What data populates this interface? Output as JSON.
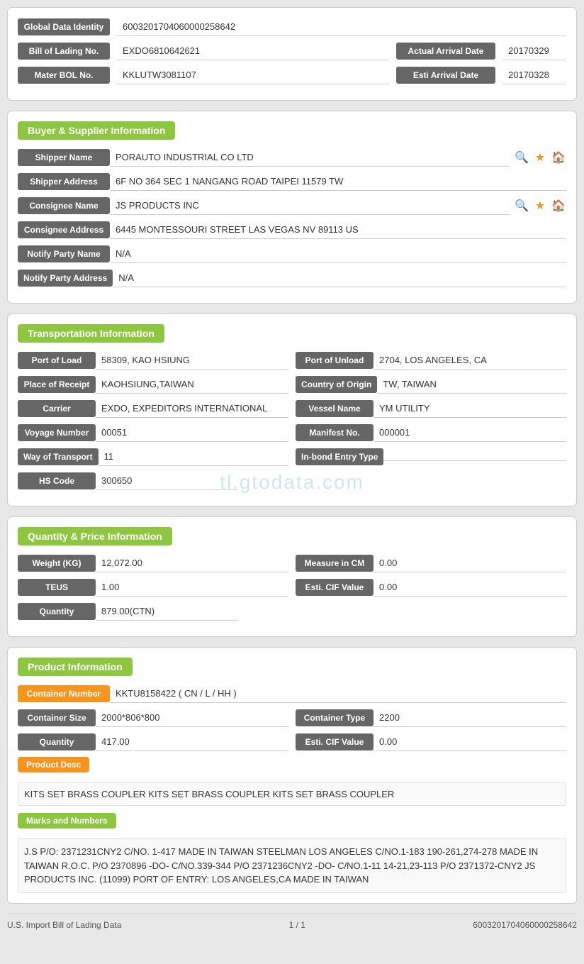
{
  "identity": {
    "global_label": "Global Data Identity",
    "global_value": "600320170406000025864​2",
    "bol_label": "Bill of Lading No.",
    "bol_value": "EXDO6810642621",
    "actual_arrival_label": "Actual Arrival Date",
    "actual_arrival_value": "20170329",
    "mater_bol_label": "Mater BOL No.",
    "mater_bol_value": "KKLUTW3081107",
    "esti_arrival_label": "Esti Arrival Date",
    "esti_arrival_value": "20170328"
  },
  "buyer_supplier": {
    "header": "Buyer & Supplier Information",
    "shipper_name_label": "Shipper Name",
    "shipper_name_value": "PORAUTO INDUSTRIAL CO LTD",
    "shipper_address_label": "Shipper Address",
    "shipper_address_value": "6F NO 364 SEC 1 NANGANG ROAD TAIPEI 11579 TW",
    "consignee_name_label": "Consignee Name",
    "consignee_name_value": "JS PRODUCTS INC",
    "consignee_address_label": "Consignee Address",
    "consignee_address_value": "6445 MONTESSOURI STREET LAS VEGAS NV 89113 US",
    "notify_party_name_label": "Notify Party Name",
    "notify_party_name_value": "N/A",
    "notify_party_address_label": "Notify Party Address",
    "notify_party_address_value": "N/A"
  },
  "transportation": {
    "header": "Transportation Information",
    "port_load_label": "Port of Load",
    "port_load_value": "58309, KAO HSIUNG",
    "port_unload_label": "Port of Unload",
    "port_unload_value": "2704, LOS ANGELES, CA",
    "place_receipt_label": "Place of Receipt",
    "place_receipt_value": "KAOHSIUNG,TAIWAN",
    "country_origin_label": "Country of Origin",
    "country_origin_value": "TW, TAIWAN",
    "carrier_label": "Carrier",
    "carrier_value": "EXDO, EXPEDITORS INTERNATIONAL",
    "vessel_name_label": "Vessel Name",
    "vessel_name_value": "YM UTILITY",
    "voyage_number_label": "Voyage Number",
    "voyage_number_value": "00051",
    "manifest_no_label": "Manifest No.",
    "manifest_no_value": "000001",
    "way_transport_label": "Way of Transport",
    "way_transport_value": "11",
    "inbond_entry_label": "In-bond Entry Type",
    "inbond_entry_value": "",
    "hs_code_label": "HS Code",
    "hs_code_value": "300650"
  },
  "quantity_price": {
    "header": "Quantity & Price Information",
    "weight_label": "Weight (KG)",
    "weight_value": "12,072.00",
    "measure_label": "Measure in CM",
    "measure_value": "0.00",
    "teus_label": "TEUS",
    "teus_value": "1.00",
    "esti_cif_label": "Esti. CIF Value",
    "esti_cif_value": "0.00",
    "quantity_label": "Quantity",
    "quantity_value": "879.00(CTN)"
  },
  "product_info": {
    "header": "Product Information",
    "container_number_label": "Container Number",
    "container_number_value": "KKTU8158422 ( CN / L / HH )",
    "container_size_label": "Container Size",
    "container_size_value": "2000*806*800",
    "container_type_label": "Container Type",
    "container_type_value": "2200",
    "quantity_label": "Quantity",
    "quantity_value": "417.00",
    "esti_cif_label": "Esti. CIF Value",
    "esti_cif_value": "0.00",
    "product_desc_label": "Product Desc",
    "product_desc_value": "KITS SET BRASS COUPLER KITS SET BRASS COUPLER KITS SET BRASS COUPLER",
    "marks_label": "Marks and Numbers",
    "marks_value": "J.S P/O: 2371231CNY2 C/NO. 1-417 MADE IN TAIWAN STEELMAN LOS ANGELES C/NO.1-183 190-261,274-278 MADE IN TAIWAN R.O.C. P/O 2370896 -DO- C/NO.339-344 P/O 2371236CNY2 -DO- C/NO.1-11 14-21,23-113 P/O 2371372-CNY2 JS PRODUCTS INC. (11099) PORT OF ENTRY: LOS ANGELES,CA MADE IN TAIWAN"
  },
  "footer": {
    "left": "U.S. Import Bill of Lading Data",
    "center": "1 / 1",
    "right": "600320170406000025864​2"
  },
  "watermark": "tl.gtodata.com"
}
